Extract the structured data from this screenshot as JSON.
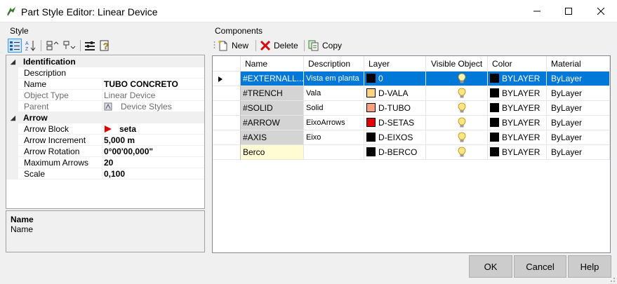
{
  "window": {
    "title": "Part Style Editor: Linear Device",
    "minimize": "─",
    "maximize": "☐",
    "close": "✕"
  },
  "style_group": {
    "label": "Style",
    "toolbar": [
      "categorized-icon",
      "alphabetical-icon",
      "expand-icon",
      "collapse-icon",
      "properties-icon",
      "help-icon"
    ]
  },
  "property_grid": {
    "categories": [
      {
        "label": "Identification",
        "properties": [
          {
            "name": "Description",
            "value": "",
            "disabled": false
          },
          {
            "name": "Name",
            "value": "TUBO CONCRETO",
            "disabled": false
          },
          {
            "name": "Object Type",
            "value": "Linear Device",
            "disabled": true
          },
          {
            "name": "Parent",
            "value": "Device Styles",
            "disabled": true
          }
        ]
      },
      {
        "label": "Arrow",
        "properties": [
          {
            "name": "Arrow Block",
            "value": "seta",
            "disabled": false
          },
          {
            "name": "Arrow Increment",
            "value": "5,000 m",
            "disabled": false
          },
          {
            "name": "Arrow Rotation",
            "value": "0°00'00,000\"",
            "disabled": false
          },
          {
            "name": "Maximum Arrows",
            "value": "20",
            "disabled": false
          },
          {
            "name": "Scale",
            "value": "0,100",
            "disabled": false
          }
        ]
      }
    ]
  },
  "description_panel": {
    "title": "Name",
    "text": "Name"
  },
  "components_group": {
    "label": "Components",
    "toolbar": {
      "new_label": "New",
      "delete_label": "Delete",
      "copy_label": "Copy"
    },
    "columns": [
      "Name",
      "Description",
      "Layer",
      "Visible Object",
      "Color",
      "Material"
    ],
    "rows": [
      {
        "name": "#EXTERNALL...",
        "description": "Vista em planta",
        "layer": "0",
        "layer_color": "#000000",
        "visible": true,
        "color": "BYLAYER",
        "material": "ByLayer",
        "selected": true
      },
      {
        "name": "#TRENCH",
        "description": "Vala",
        "layer": "D-VALA",
        "layer_color": "#ffd47f",
        "visible": true,
        "color": "BYLAYER",
        "material": "ByLayer",
        "selected": false
      },
      {
        "name": "#SOLID",
        "description": "Solid",
        "layer": "D-TUBO",
        "layer_color": "#ff9f7f",
        "visible": true,
        "color": "BYLAYER",
        "material": "ByLayer",
        "selected": false
      },
      {
        "name": "#ARROW",
        "description": "EixoArrows",
        "layer": "D-SETAS",
        "layer_color": "#e00000",
        "visible": true,
        "color": "BYLAYER",
        "material": "ByLayer",
        "selected": false
      },
      {
        "name": "#AXIS",
        "description": "Eixo",
        "layer": "D-EIXOS",
        "layer_color": "#000000",
        "visible": true,
        "color": "BYLAYER",
        "material": "ByLayer",
        "selected": false
      },
      {
        "name": "Berco",
        "description": "",
        "layer": "D-BERCO",
        "layer_color": "#000000",
        "visible": true,
        "color": "BYLAYER",
        "material": "ByLayer",
        "selected": false
      }
    ]
  },
  "buttons": {
    "ok": "OK",
    "cancel": "Cancel",
    "help": "Help"
  },
  "colors": {
    "selection": "#0078d7",
    "arrow_marker": "#e00000",
    "new_row": "#fffbd3"
  }
}
